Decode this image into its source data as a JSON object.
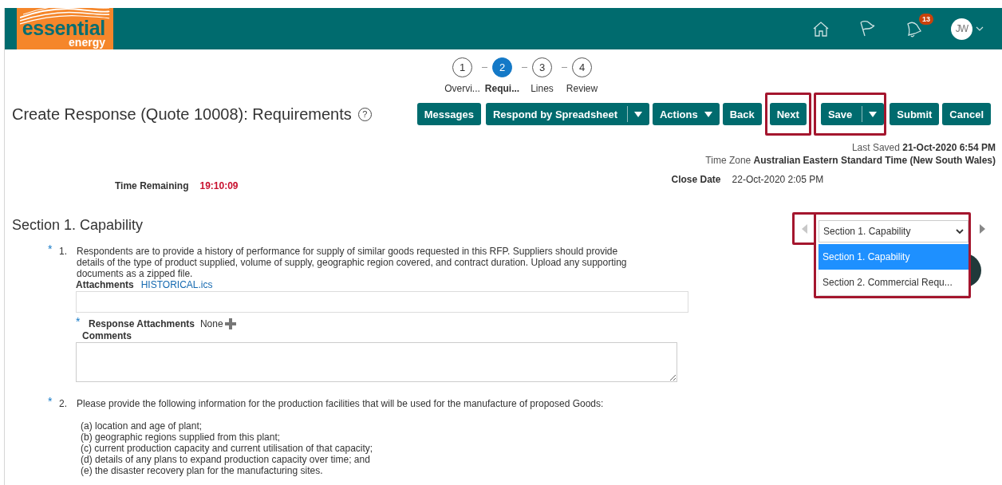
{
  "header": {
    "logo": {
      "word_1": "essential",
      "word_2": "energy"
    },
    "notification_count": "13",
    "user_initials": "JW"
  },
  "train": [
    {
      "number": "1",
      "label": "Overvi...",
      "selected": false
    },
    {
      "number": "2",
      "label": "Requi...",
      "selected": true
    },
    {
      "number": "3",
      "label": "Lines",
      "selected": false
    },
    {
      "number": "4",
      "label": "Review",
      "selected": false
    }
  ],
  "page_title": "Create Response (Quote 10008): Requirements",
  "help_glyph": "?",
  "toolbar": [
    {
      "label": "Messages",
      "kind": "button",
      "highlighted": false
    },
    {
      "label": "Respond by Spreadsheet",
      "kind": "split",
      "highlighted": false
    },
    {
      "label": "Actions",
      "kind": "menu",
      "highlighted": false
    },
    {
      "label": "Back",
      "kind": "button",
      "highlighted": false
    },
    {
      "label": "Next",
      "kind": "button",
      "highlighted": true
    },
    {
      "label": "Save",
      "kind": "split",
      "highlighted": true
    },
    {
      "label": "Submit",
      "kind": "button",
      "highlighted": false
    },
    {
      "label": "Cancel",
      "kind": "button",
      "highlighted": false
    }
  ],
  "last_saved": {
    "label": "Last Saved",
    "value": "21-Oct-2020 6:54 PM"
  },
  "time_zone": {
    "label": "Time Zone",
    "value": "Australian Eastern Standard Time (New South Wales)"
  },
  "time_remaining": {
    "label": "Time Remaining",
    "value": "19:10:09"
  },
  "close_date": {
    "label": "Close Date",
    "value": "22-Oct-2020 2:05 PM"
  },
  "section": {
    "title": "Section 1. Capability",
    "prev_highlighted": true,
    "dropdown": {
      "value": "Section 1. Capability",
      "highlighted": true,
      "expanded": true,
      "options": [
        {
          "label": "Section 1. Capability",
          "selected": true
        },
        {
          "label": "Section 2. Commercial Requ...",
          "selected": false
        }
      ]
    }
  },
  "questions": [
    {
      "kind": "response",
      "required_mark": "*",
      "number": "1.",
      "text": "Respondents are to provide a history of performance for supply of similar goods requested in this RFP. Suppliers should provide details of the type of product supplied, volume of supply, geographic region covered, and contract duration. Upload any supporting documents as a zipped file.",
      "attachments_label": "Attachments",
      "attachment_link": "HISTORICAL.ics",
      "response_required_mark": "*",
      "response_attachments_label": "Response Attachments",
      "response_attachments_value": "None",
      "comments_label": "Comments"
    },
    {
      "kind": "list",
      "required_mark": "*",
      "number": "2.",
      "text": "Please provide the following information for the production facilities that will be used for the manufacture of proposed Goods:",
      "items": [
        "(a) location and age of plant;",
        "(b) geographic regions supplied from this plant;",
        "(c) current production capacity and current utilisation of that capacity;",
        "(d) details of any plans to expand production capacity over time; and",
        "(e) the disaster recovery plan for the manufacturing sites."
      ]
    }
  ]
}
